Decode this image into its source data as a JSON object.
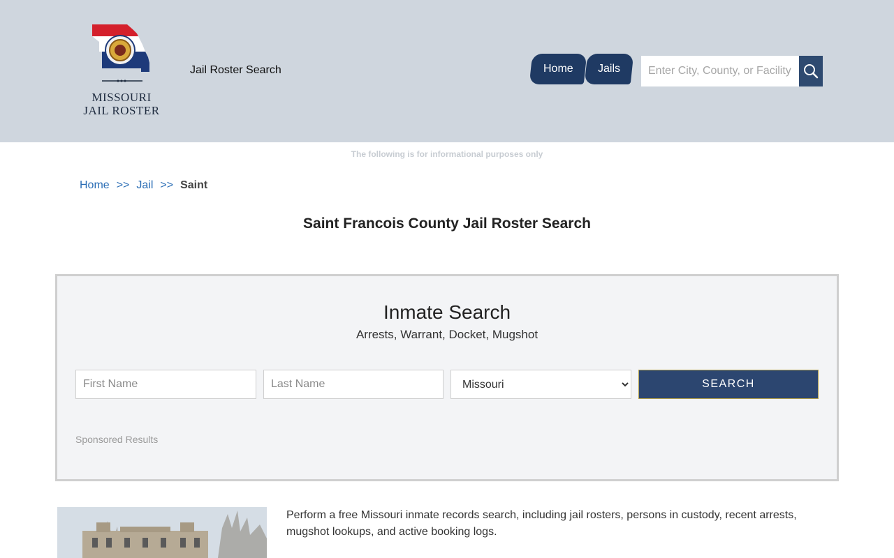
{
  "header": {
    "logo_line1": "MISSOURI",
    "logo_line2": "JAIL ROSTER",
    "site_title": "Jail Roster Search",
    "nav": [
      {
        "label": "Home"
      },
      {
        "label": "Jails"
      }
    ],
    "search_placeholder": "Enter City, County, or Facility"
  },
  "disclaimer": "The following is for informational purposes only",
  "breadcrumb": {
    "items": [
      "Home",
      "Jail"
    ],
    "separator": ">>",
    "current": "Saint"
  },
  "page_title": "Saint Francois County Jail Roster Search",
  "inmate_search": {
    "title": "Inmate Search",
    "subtitle": "Arrests, Warrant, Docket, Mugshot",
    "first_name_placeholder": "First Name",
    "last_name_placeholder": "Last Name",
    "state_selected": "Missouri",
    "submit_label": "SEARCH",
    "sponsored": "Sponsored Results"
  },
  "description": "Perform a free Missouri inmate records search, including jail rosters, persons in custody, recent arrests, mugshot lookups, and active booking logs.",
  "colors": {
    "header_bg": "#cfd6de",
    "nav_bg": "#1f3a63",
    "button_bg": "#2c4670",
    "link": "#2a6db5"
  }
}
